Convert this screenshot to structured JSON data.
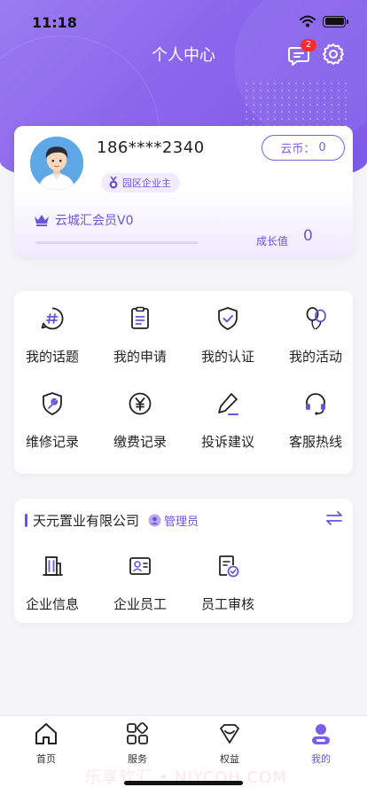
{
  "status_bar": {
    "time": "11:18"
  },
  "header": {
    "title": "个人中心",
    "message_badge": "2"
  },
  "profile": {
    "phone": "186****2340",
    "role_badge": "园区企业主",
    "coin_label": "云币：",
    "coin_value": "0",
    "member_level": "云城汇会员V0",
    "growth_label": "成长值",
    "growth_value": "0",
    "growth_progress": 0
  },
  "services": [
    {
      "label": "我的话题",
      "icon": "hashtag-chat-icon"
    },
    {
      "label": "我的申请",
      "icon": "clipboard-icon"
    },
    {
      "label": "我的认证",
      "icon": "shield-check-icon"
    },
    {
      "label": "我的活动",
      "icon": "balloons-icon"
    },
    {
      "label": "维修记录",
      "icon": "wrench-shield-icon"
    },
    {
      "label": "缴费记录",
      "icon": "yuan-icon"
    },
    {
      "label": "投诉建议",
      "icon": "pencil-icon"
    },
    {
      "label": "客服热线",
      "icon": "headset-icon"
    }
  ],
  "company": {
    "name": "天元置业有限公司",
    "role": "管理员",
    "items": [
      {
        "label": "企业信息",
        "icon": "building-icon"
      },
      {
        "label": "企业员工",
        "icon": "id-card-icon"
      },
      {
        "label": "员工审核",
        "icon": "document-check-icon"
      }
    ]
  },
  "tabbar": [
    {
      "label": "首页",
      "icon": "home-icon",
      "active": false
    },
    {
      "label": "服务",
      "icon": "apps-icon",
      "active": false
    },
    {
      "label": "权益",
      "icon": "gem-icon",
      "active": false
    },
    {
      "label": "我的",
      "icon": "user-icon",
      "active": true
    }
  ],
  "watermark": "乐享软汇 • NIYCOH.COM",
  "colors": {
    "primary": "#7a5ee6",
    "badge": "#ff2a2a",
    "background": "#f5f5f7"
  }
}
